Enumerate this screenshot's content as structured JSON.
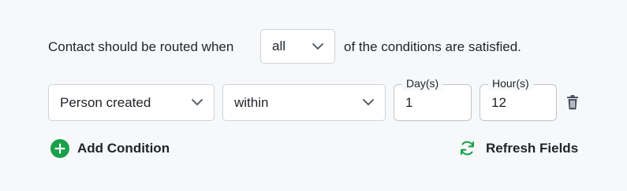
{
  "sentence": {
    "prefix": "Contact should be routed when",
    "suffix": "of the conditions are satisfied."
  },
  "match_select": {
    "value": "all"
  },
  "condition": {
    "field_select": {
      "value": "Person created"
    },
    "operator_select": {
      "value": "within"
    },
    "days": {
      "label": "Day(s)",
      "value": "1"
    },
    "hours": {
      "label": "Hour(s)",
      "value": "12"
    }
  },
  "actions": {
    "add_condition": "Add Condition",
    "refresh_fields": "Refresh Fields"
  },
  "colors": {
    "accent_green": "#1aa04a",
    "icon_gray": "#4a5260",
    "border": "#cfd3d8"
  },
  "icons": [
    "chevron-down-icon",
    "trash-icon",
    "plus-circle-icon",
    "refresh-icon"
  ]
}
